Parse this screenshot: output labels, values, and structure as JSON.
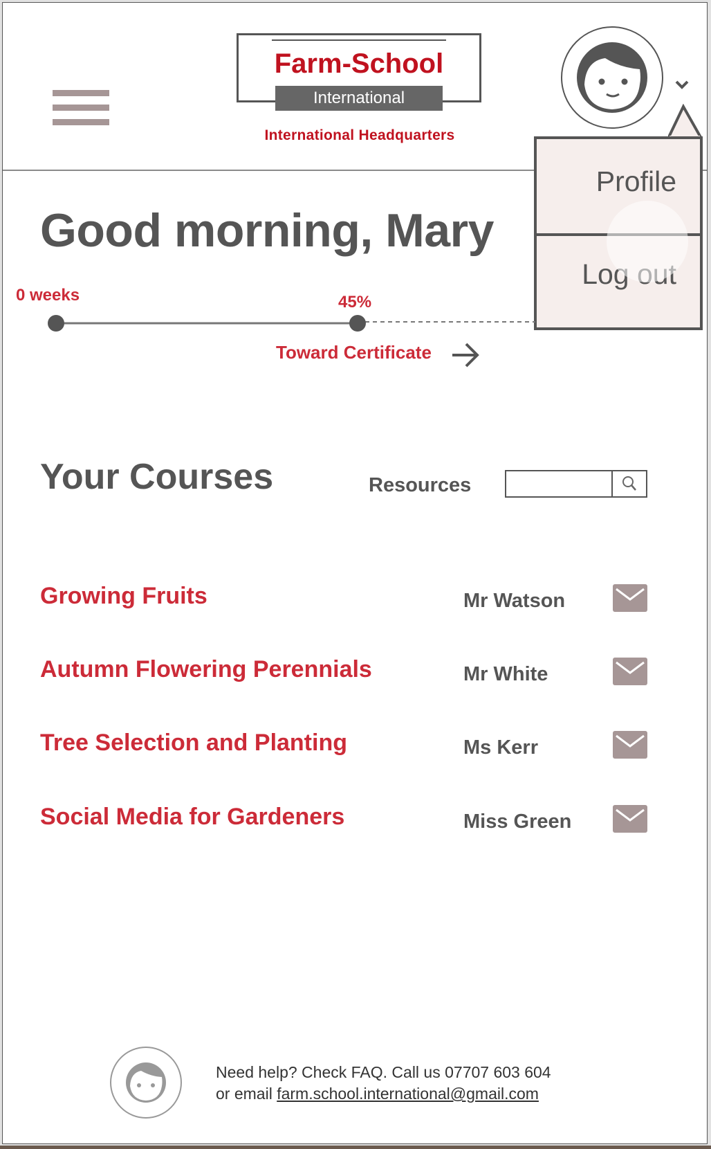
{
  "header": {
    "logo": {
      "name": "Farm-School",
      "tagline": "International",
      "subtitle": "International Headquarters"
    },
    "menu_icon": "hamburger-icon",
    "avatar_icon": "user-face-icon",
    "dropdown_icon": "chevron-down-icon"
  },
  "user_menu": {
    "items": [
      {
        "label": "Profile"
      },
      {
        "label": "Log out"
      }
    ]
  },
  "greeting": "Good morning, Mary",
  "progress": {
    "start_label": "0 weeks",
    "percent_label": "45%",
    "percent_value": 45,
    "target_label": "Toward Certificate"
  },
  "courses": {
    "title": "Your Courses",
    "resources_label": "Resources",
    "search_value": "",
    "items": [
      {
        "name": "Growing Fruits",
        "teacher": "Mr Watson"
      },
      {
        "name": "Autumn Flowering Perennials",
        "teacher": "Mr White"
      },
      {
        "name": "Tree Selection and Planting",
        "teacher": "Ms Kerr"
      },
      {
        "name": "Social Media for Gardeners",
        "teacher": "Miss Green"
      }
    ]
  },
  "footer": {
    "line1": "Need help? Check FAQ. Call us 07707 603 604",
    "line2_prefix": "or email ",
    "email": "farm.school.international@gmail.com"
  },
  "colors": {
    "accent_red": "#cc2b38",
    "text_gray": "#555555",
    "icon_mauve": "#a69696",
    "menu_bg": "#f6eeec"
  }
}
